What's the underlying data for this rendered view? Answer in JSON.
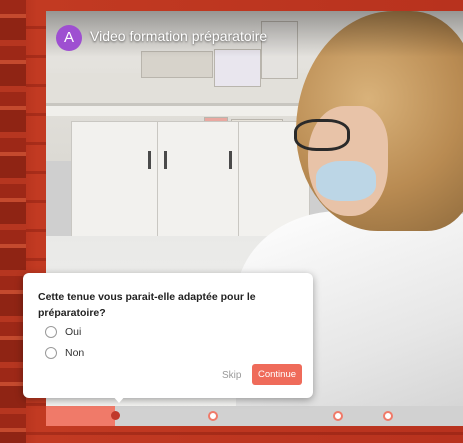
{
  "player": {
    "avatar_letter": "A",
    "title": "Video formation préparatoire",
    "accent_color": "#ef6b5a",
    "avatar_color": "#9e4fd1"
  },
  "timeline": {
    "progress_fraction": 0.165,
    "markers": [
      0.4,
      0.7,
      0.82
    ]
  },
  "quiz": {
    "question": "Cette tenue vous parait-elle adaptée pour le préparatoire?",
    "options": [
      "Oui",
      "Non"
    ],
    "skip_label": "Skip",
    "continue_label": "Continue"
  }
}
